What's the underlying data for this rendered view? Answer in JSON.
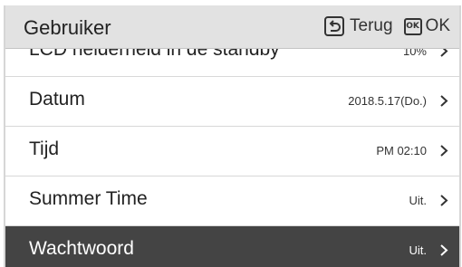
{
  "header": {
    "title": "Gebruiker",
    "back_label": "Terug",
    "ok_badge": "OK",
    "ok_label": "OK",
    "icons": [
      "back-arrow-icon",
      "ok-key-icon"
    ]
  },
  "settings": {
    "rows": [
      {
        "label": "LCD helderheid in de standby",
        "value": "10%"
      },
      {
        "label": "Datum",
        "value": "2018.5.17(Do.)"
      },
      {
        "label": "Tijd",
        "value": "PM 02:10"
      },
      {
        "label": "Summer Time",
        "value": "Uit."
      },
      {
        "label": "Wachtwoord",
        "value": "Uit."
      }
    ],
    "selected_label": "Wachtwoord"
  },
  "colors": {
    "header_bg": "#e2e2e2",
    "selected_bg": "#444444",
    "row_bg": "#ffffff"
  }
}
